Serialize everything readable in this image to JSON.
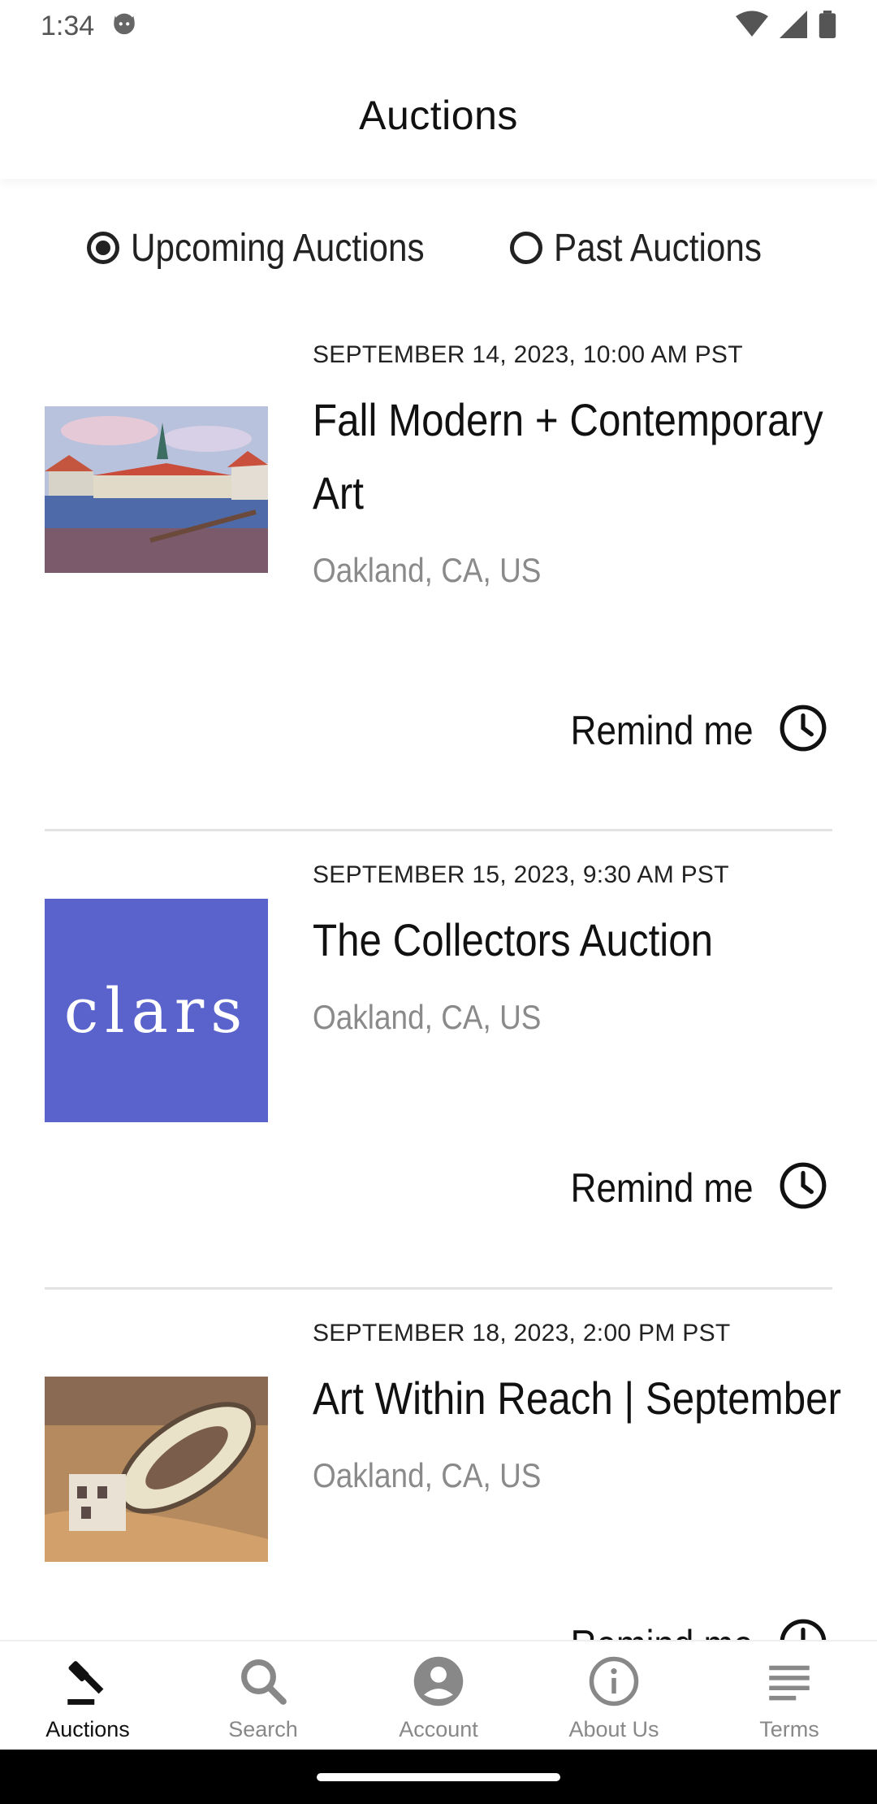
{
  "status": {
    "time": "1:34"
  },
  "header": {
    "title": "Auctions"
  },
  "filter": {
    "options": [
      {
        "label": "Upcoming Auctions",
        "selected": true
      },
      {
        "label": "Past Auctions",
        "selected": false
      }
    ]
  },
  "auctions": [
    {
      "date": "SEPTEMBER 14, 2023, 10:00 AM PST",
      "title": "Fall Modern + Contemporary Art",
      "location": "Oakland, CA, US",
      "remind_label": "Remind me"
    },
    {
      "date": "SEPTEMBER 15, 2023, 9:30 AM PST",
      "title": "The Collectors Auction",
      "location": "Oakland, CA, US",
      "remind_label": "Remind me",
      "logo_text": "clars"
    },
    {
      "date": "SEPTEMBER 18, 2023, 2:00 PM PST",
      "title": "Art Within Reach | September",
      "location": "Oakland, CA, US",
      "remind_label": "Remind me"
    }
  ],
  "colors": {
    "clars_blue": "#5a63cc",
    "accent": "#111111"
  },
  "nav": {
    "items": [
      {
        "label": "Auctions",
        "icon": "gavel-icon",
        "active": true
      },
      {
        "label": "Search",
        "icon": "search-icon",
        "active": false
      },
      {
        "label": "Account",
        "icon": "account-icon",
        "active": false
      },
      {
        "label": "About Us",
        "icon": "info-icon",
        "active": false
      },
      {
        "label": "Terms",
        "icon": "notes-icon",
        "active": false
      }
    ]
  }
}
